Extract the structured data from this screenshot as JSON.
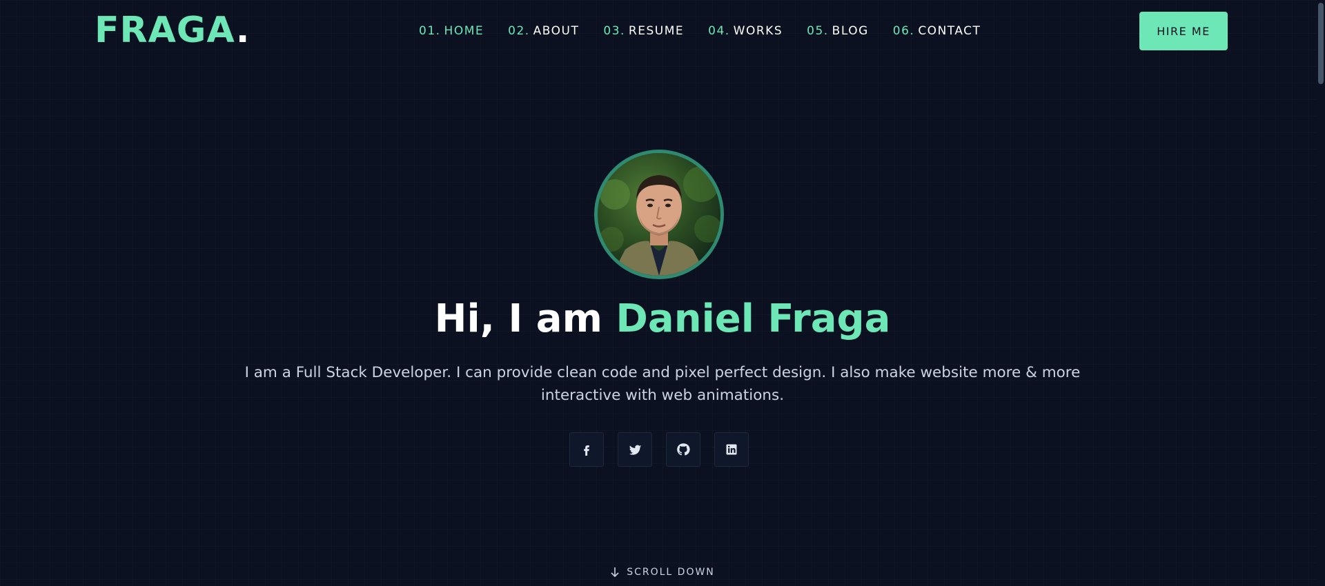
{
  "brand": {
    "logo_text": "FRAGA",
    "logo_dot": "."
  },
  "nav": {
    "items": [
      {
        "num": "01.",
        "label": "HOME",
        "active": true
      },
      {
        "num": "02.",
        "label": "ABOUT",
        "active": false
      },
      {
        "num": "03.",
        "label": "RESUME",
        "active": false
      },
      {
        "num": "04.",
        "label": "WORKS",
        "active": false
      },
      {
        "num": "05.",
        "label": "BLOG",
        "active": false
      },
      {
        "num": "06.",
        "label": "CONTACT",
        "active": false
      }
    ],
    "cta_label": "HIRE ME"
  },
  "hero": {
    "greeting": "Hi, I am ",
    "name": "Daniel Fraga",
    "description": "I am a Full Stack Developer. I can provide clean code and pixel perfect design. I also make website more & more interactive with web animations.",
    "socials": [
      {
        "icon": "facebook-icon"
      },
      {
        "icon": "twitter-icon"
      },
      {
        "icon": "github-icon"
      },
      {
        "icon": "linkedin-icon"
      }
    ],
    "scroll_label": "SCROLL DOWN"
  },
  "colors": {
    "background": "#0b1120",
    "accent": "#6ee7b7",
    "text": "#ffffff",
    "muted_text": "#cbd5e1"
  }
}
